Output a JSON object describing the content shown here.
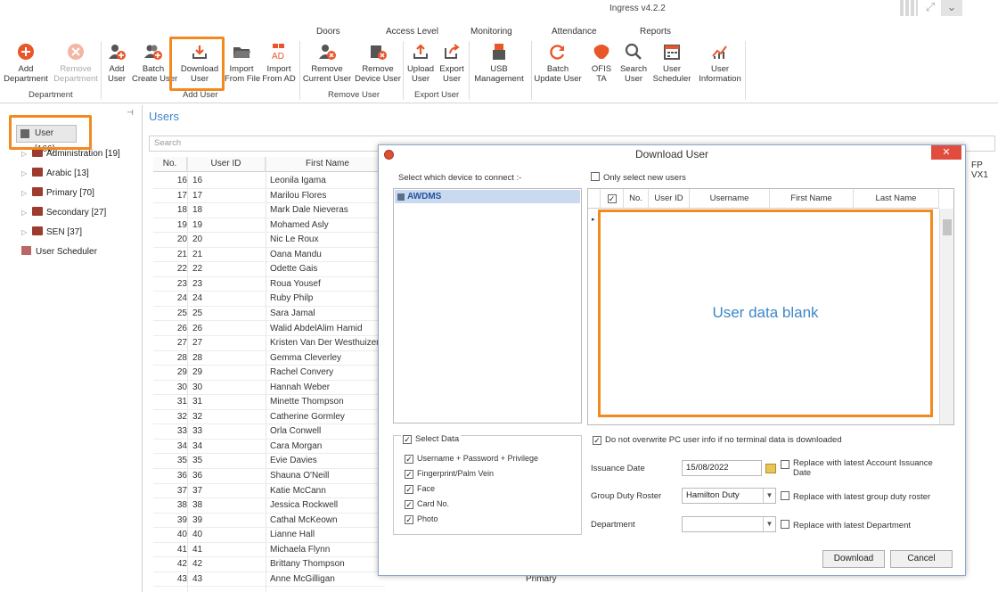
{
  "app": {
    "title": "Ingress v4.2.2"
  },
  "ribbon": {
    "tabs": [
      "Doors",
      "Access Level",
      "Monitoring",
      "Attendance",
      "Reports"
    ],
    "buttons": {
      "add_department": "Add\nDepartment",
      "remove_department": "Remove\nDepartment",
      "add_user": "Add\nUser",
      "batch_create_user": "Batch\nCreate User",
      "download_user": "Download\nUser",
      "import_from_file": "Import\nFrom File",
      "import_from_ad": "Import\nFrom AD",
      "remove_current_user": "Remove\nCurrent User",
      "remove_device_user": "Remove\nDevice User",
      "upload_user": "Upload\nUser",
      "export_user": "Export\nUser",
      "usb_management": "USB\nManagement",
      "batch_update_user": "Batch\nUpdate User",
      "ofis_ta": "OFIS\nTA",
      "search_user": "Search\nUser",
      "user_scheduler": "User\nScheduler",
      "user_information": "User\nInformation"
    },
    "groups": {
      "department": "Department",
      "add_user": "Add User",
      "remove_user": "Remove User",
      "export_user": "Export User"
    }
  },
  "tree": {
    "root": "User [166]",
    "items": [
      {
        "label": "Administration [19]"
      },
      {
        "label": "Arabic [13]"
      },
      {
        "label": "Primary [70]"
      },
      {
        "label": "Secondary [27]"
      },
      {
        "label": "SEN [37]"
      }
    ],
    "scheduler": "User Scheduler"
  },
  "main": {
    "title": "Users",
    "search_placeholder": "Search",
    "columns": {
      "no": "No.",
      "user_id": "User ID",
      "first_name": "First Name",
      "fp": "FP VX1"
    },
    "rows": [
      {
        "no": "16",
        "id": "16",
        "name": "Leonila Igama"
      },
      {
        "no": "17",
        "id": "17",
        "name": "Marilou Flores"
      },
      {
        "no": "18",
        "id": "18",
        "name": "Mark Dale Nieveras"
      },
      {
        "no": "19",
        "id": "19",
        "name": "Mohamed Asly"
      },
      {
        "no": "20",
        "id": "20",
        "name": "Nic Le Roux"
      },
      {
        "no": "21",
        "id": "21",
        "name": "Oana Mandu"
      },
      {
        "no": "22",
        "id": "22",
        "name": "Odette Gais"
      },
      {
        "no": "23",
        "id": "23",
        "name": "Roua Yousef"
      },
      {
        "no": "24",
        "id": "24",
        "name": "Ruby Philp"
      },
      {
        "no": "25",
        "id": "25",
        "name": "Sara Jamal"
      },
      {
        "no": "26",
        "id": "26",
        "name": "Walid AbdelAlim Hamid"
      },
      {
        "no": "27",
        "id": "27",
        "name": "Kristen Van Der Westhuizen"
      },
      {
        "no": "28",
        "id": "28",
        "name": "Gemma Cleverley"
      },
      {
        "no": "29",
        "id": "29",
        "name": "Rachel Convery"
      },
      {
        "no": "30",
        "id": "30",
        "name": "Hannah Weber"
      },
      {
        "no": "31",
        "id": "31",
        "name": "Minette Thompson"
      },
      {
        "no": "32",
        "id": "32",
        "name": "Catherine Gormley"
      },
      {
        "no": "33",
        "id": "33",
        "name": "Orla Conwell"
      },
      {
        "no": "34",
        "id": "34",
        "name": "Cara Morgan"
      },
      {
        "no": "35",
        "id": "35",
        "name": "Evie Davies"
      },
      {
        "no": "36",
        "id": "36",
        "name": "Shauna O'Neill"
      },
      {
        "no": "37",
        "id": "37",
        "name": "Katie McCann"
      },
      {
        "no": "38",
        "id": "38",
        "name": "Jessica Rockwell"
      },
      {
        "no": "39",
        "id": "39",
        "name": "Cathal McKeown"
      },
      {
        "no": "40",
        "id": "40",
        "name": "Lianne Hall"
      },
      {
        "no": "41",
        "id": "41",
        "name": "Michaela Flynn"
      },
      {
        "no": "42",
        "id": "42",
        "name": "Brittany Thompson"
      },
      {
        "no": "43",
        "id": "43",
        "name": "Anne McGilligan"
      }
    ],
    "dept_cell": "Primary"
  },
  "dialog": {
    "title": "Download User",
    "select_device_label": "Select which device to connect :-",
    "device": "AWDMS",
    "only_new_users": "Only select new users",
    "grid_columns": {
      "no": "No.",
      "user_id": "User ID",
      "username": "Username",
      "first_name": "First Name",
      "last_name": "Last Name"
    },
    "annotation": "User data blank",
    "select_data": "Select Data",
    "data_options": [
      "Username + Password + Privilege",
      "Fingerprint/Palm Vein",
      "Face",
      "Card No.",
      "Photo"
    ],
    "no_overwrite": "Do not overwrite PC user info if no terminal data is downloaded",
    "issuance_label": "Issuance Date",
    "issuance_value": "15/08/2022",
    "replace_issuance": "Replace with latest Account Issuance Date",
    "roster_label": "Group Duty Roster",
    "roster_value": "Hamilton Duty",
    "replace_roster": "Replace with latest group duty roster",
    "department_label": "Department",
    "department_value": "",
    "replace_department": "Replace with latest Department",
    "download_btn": "Download",
    "cancel_btn": "Cancel"
  }
}
